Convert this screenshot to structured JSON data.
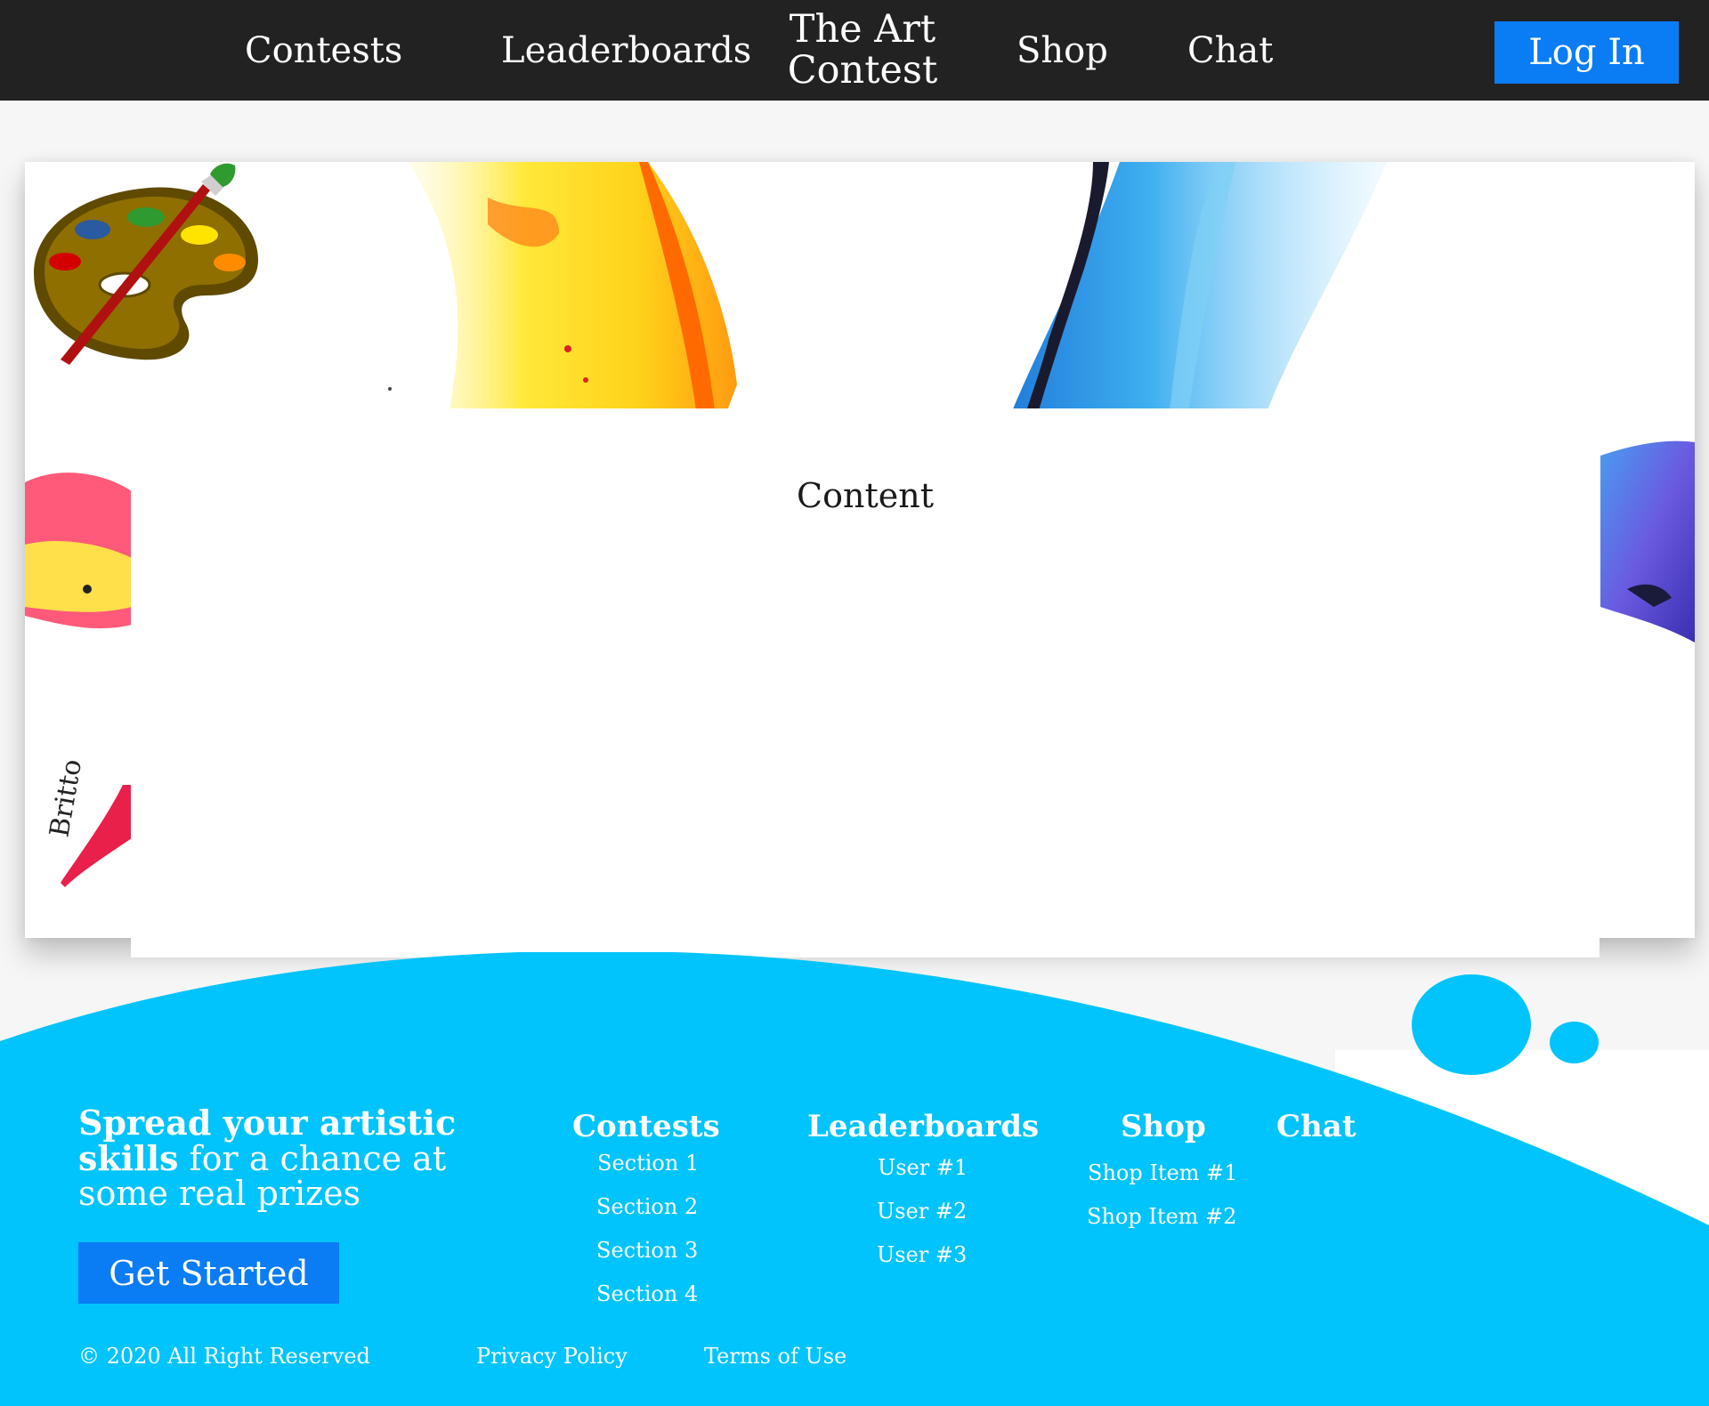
{
  "nav": {
    "links": [
      "Contests",
      "Leaderboards",
      "Shop",
      "Chat"
    ],
    "brand_line1": "The Art",
    "brand_line2": "Contest",
    "login_label": "Log In"
  },
  "hero": {
    "signature_text": "Britto"
  },
  "content": {
    "title": "Content"
  },
  "footer": {
    "tagline_bold": "Spread your artistic skills",
    "tagline_rest": " for a chance at some real prizes",
    "cta_label": "Get Started",
    "columns": {
      "contests": {
        "title": "Contests",
        "items": [
          "Section 1",
          "Section 2",
          "Section 3",
          "Section 4"
        ]
      },
      "leaderboards": {
        "title": "Leaderboards",
        "items": [
          "User #1",
          "User #2",
          "User #3"
        ]
      },
      "shop": {
        "title": "Shop",
        "items": [
          "Shop Item #1",
          "Shop Item #2"
        ]
      },
      "chat": {
        "title": "Chat",
        "items": []
      }
    },
    "copyright": "© 2020 All Right Reserved",
    "privacy": "Privacy Policy",
    "terms": "Terms of Use"
  },
  "colors": {
    "nav_bg": "#222222",
    "accent_blue": "#0a7cf4",
    "footer_cyan": "#00c4fb",
    "page_bg": "#f6f6f6"
  },
  "icons": [
    "palette-icon"
  ]
}
